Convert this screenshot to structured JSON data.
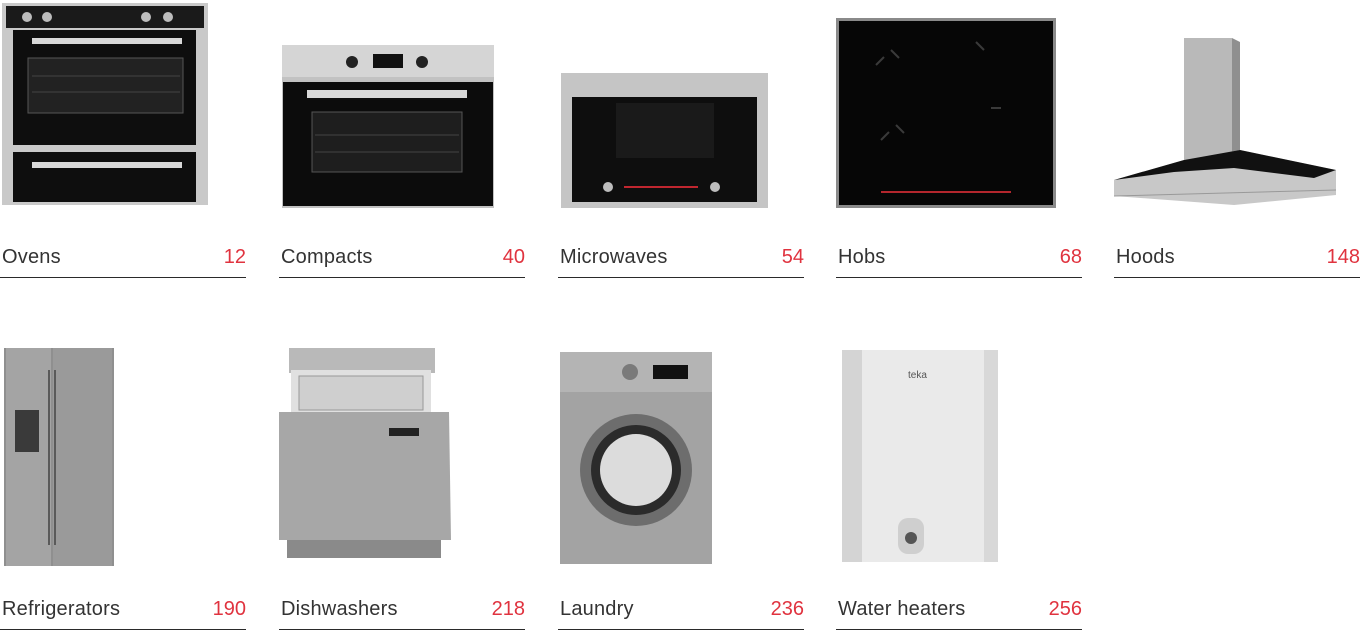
{
  "accent_color": "#e0333f",
  "rows": [
    {
      "items": [
        {
          "name": "ovens",
          "label": "Ovens",
          "page": "12",
          "icon": "oven-icon"
        },
        {
          "name": "compacts",
          "label": "Compacts",
          "page": "40",
          "icon": "compact-oven-icon"
        },
        {
          "name": "microwaves",
          "label": "Microwaves",
          "page": "54",
          "icon": "microwave-icon"
        },
        {
          "name": "hobs",
          "label": "Hobs",
          "page": "68",
          "icon": "hob-icon"
        },
        {
          "name": "hoods",
          "label": "Hoods",
          "page": "148",
          "icon": "hood-icon"
        }
      ]
    },
    {
      "items": [
        {
          "name": "refrigerators",
          "label": "Refrigerators",
          "page": "190",
          "icon": "refrigerator-icon"
        },
        {
          "name": "dishwashers",
          "label": "Dishwashers",
          "page": "218",
          "icon": "dishwasher-icon"
        },
        {
          "name": "laundry",
          "label": "Laundry",
          "page": "236",
          "icon": "washing-machine-icon"
        },
        {
          "name": "water-heaters",
          "label": "Water heaters",
          "page": "256",
          "icon": "water-heater-icon"
        }
      ]
    }
  ]
}
